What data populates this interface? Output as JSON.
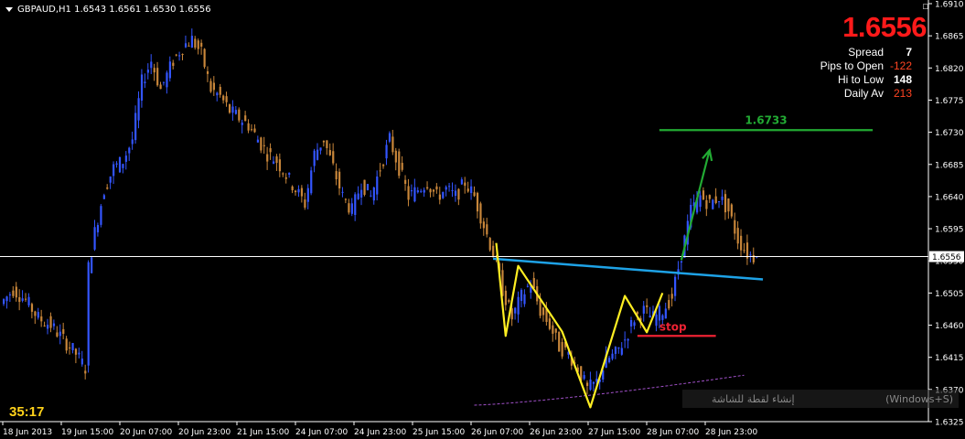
{
  "header": {
    "text": "GBPAUD,H1  1.6543 1.6561 1.6530 1.6556"
  },
  "price_display": {
    "value": "1.6556",
    "stats": [
      {
        "label": "Spread",
        "value": "7",
        "color": "#ffffff"
      },
      {
        "label": "Pips to Open",
        "value": "-122",
        "color": "#ff4422"
      },
      {
        "label": "Hi to Low",
        "value": "148",
        "color": "#ffffff"
      },
      {
        "label": "Daily Av",
        "value": "213",
        "color": "#ff4422"
      }
    ]
  },
  "timer": "35:17",
  "tooltip": {
    "text_rtl": "إنشاء لقطة للشاشة",
    "shortcut": "(Windows+S)"
  },
  "colors": {
    "background": "#000000",
    "bull": "#3355ff",
    "bear": "#c8863a",
    "axis_text": "#ffffff",
    "neckline": "#1ea2e6",
    "pattern": "#ffee22",
    "target": "#22aa33",
    "stop": "#ee2233",
    "ma": "#a050c8"
  },
  "chart_data": {
    "type": "candlestick",
    "symbol": "GBPAUD",
    "timeframe": "H1",
    "ylim": [
      1.6325,
      1.691
    ],
    "y_ticks": [
      "1.6910",
      "1.6865",
      "1.6820",
      "1.6775",
      "1.6730",
      "1.6685",
      "1.6640",
      "1.6595",
      "1.6550",
      "1.6505",
      "1.6460",
      "1.6415",
      "1.6370",
      "1.6325"
    ],
    "x_ticks": [
      "18 Jun 2013",
      "19 Jun 15:00",
      "20 Jun 07:00",
      "20 Jun 23:00",
      "21 Jun 15:00",
      "24 Jun 07:00",
      "24 Jun 23:00",
      "25 Jun 15:00",
      "26 Jun 07:00",
      "26 Jun 23:00",
      "27 Jun 15:00",
      "28 Jun 07:00",
      "28 Jun 23:00"
    ],
    "current_price": 1.6556,
    "close_path": [
      [
        0,
        1.649
      ],
      [
        4,
        1.651
      ],
      [
        8,
        1.6495
      ],
      [
        12,
        1.647
      ],
      [
        16,
        1.646
      ],
      [
        20,
        1.644
      ],
      [
        24,
        1.642
      ],
      [
        27,
        1.64
      ],
      [
        28,
        1.654
      ],
      [
        30,
        1.659
      ],
      [
        33,
        1.665
      ],
      [
        36,
        1.668
      ],
      [
        39,
        1.669
      ],
      [
        42,
        1.672
      ],
      [
        45,
        1.68
      ],
      [
        48,
        1.683
      ],
      [
        51,
        1.679
      ],
      [
        53,
        1.681
      ],
      [
        55,
        1.683
      ],
      [
        58,
        1.685
      ],
      [
        61,
        1.686
      ],
      [
        64,
        1.684
      ],
      [
        67,
        1.679
      ],
      [
        70,
        1.678
      ],
      [
        73,
        1.676
      ],
      [
        76,
        1.675
      ],
      [
        79,
        1.674
      ],
      [
        82,
        1.672
      ],
      [
        85,
        1.67
      ],
      [
        88,
        1.669
      ],
      [
        91,
        1.667
      ],
      [
        94,
        1.665
      ],
      [
        97,
        1.663
      ],
      [
        100,
        1.67
      ],
      [
        103,
        1.672
      ],
      [
        106,
        1.668
      ],
      [
        109,
        1.664
      ],
      [
        112,
        1.662
      ],
      [
        115,
        1.666
      ],
      [
        118,
        1.664
      ],
      [
        121,
        1.668
      ],
      [
        124,
        1.672
      ],
      [
        127,
        1.668
      ],
      [
        130,
        1.664
      ],
      [
        133,
        1.665
      ],
      [
        136,
        1.666
      ],
      [
        139,
        1.664
      ],
      [
        142,
        1.665
      ],
      [
        145,
        1.664
      ],
      [
        148,
        1.666
      ],
      [
        151,
        1.664
      ],
      [
        154,
        1.66
      ],
      [
        157,
        1.656
      ],
      [
        160,
        1.651
      ],
      [
        163,
        1.647
      ],
      [
        166,
        1.65
      ],
      [
        169,
        1.652
      ],
      [
        172,
        1.648
      ],
      [
        175,
        1.646
      ],
      [
        178,
        1.643
      ],
      [
        181,
        1.642
      ],
      [
        184,
        1.64
      ],
      [
        187,
        1.637
      ],
      [
        190,
        1.638
      ],
      [
        193,
        1.641
      ],
      [
        196,
        1.642
      ],
      [
        199,
        1.644
      ],
      [
        202,
        1.647
      ],
      [
        205,
        1.648
      ],
      [
        208,
        1.647
      ],
      [
        211,
        1.648
      ],
      [
        214,
        1.65
      ],
      [
        217,
        1.656
      ],
      [
        220,
        1.662
      ],
      [
        223,
        1.664
      ],
      [
        226,
        1.663
      ],
      [
        229,
        1.664
      ],
      [
        232,
        1.662
      ],
      [
        235,
        1.658
      ],
      [
        238,
        1.656
      ],
      [
        240,
        1.6556
      ]
    ],
    "annotations": {
      "target_label": "1.6733",
      "target_level": 1.6733,
      "stop_label": "stop",
      "stop_level": 1.6445,
      "neckline": {
        "from": [
          156,
          1.6553
        ],
        "to": [
          242,
          1.6524
        ]
      },
      "pattern": [
        [
          157,
          1.6575
        ],
        [
          160,
          1.6445
        ],
        [
          164,
          1.6543
        ],
        [
          178,
          1.6451
        ],
        [
          187,
          1.6345
        ],
        [
          198,
          1.6501
        ],
        [
          205,
          1.645
        ],
        [
          210,
          1.6505
        ]
      ],
      "arrow": {
        "from": [
          216,
          1.6551
        ],
        "to": [
          225,
          1.6705
        ]
      },
      "ma_range": [
        1.6348,
        1.639
      ]
    }
  }
}
